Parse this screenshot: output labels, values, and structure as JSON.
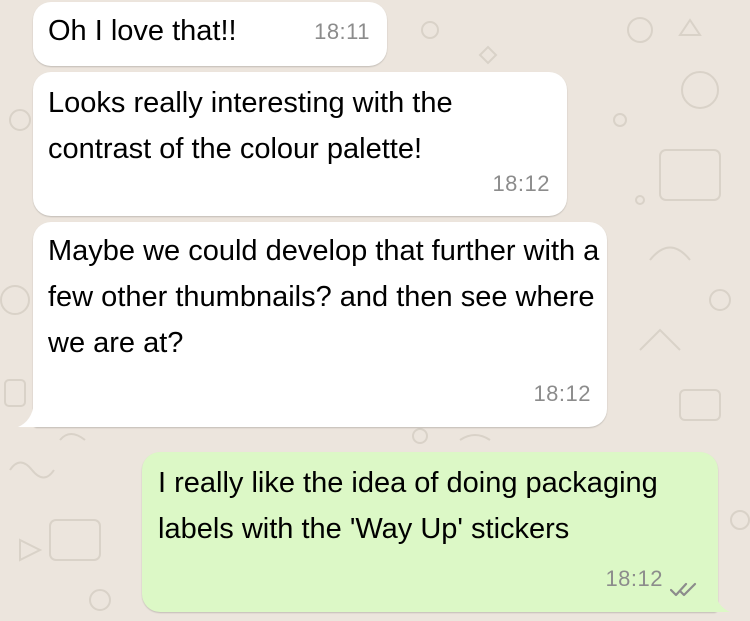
{
  "chat": {
    "messages": [
      {
        "direction": "incoming",
        "text": "Oh I love that!!",
        "time": "18:11"
      },
      {
        "direction": "incoming",
        "text": "Looks really interesting with the contrast of the colour palette!",
        "time": "18:12"
      },
      {
        "direction": "incoming",
        "text": "Maybe we could develop that further with a few other thumbnails? and then see where we are at?",
        "time": "18:12"
      },
      {
        "direction": "outgoing",
        "text": "I really like the idea of doing packaging labels with the 'Way Up' stickers",
        "time": "18:12",
        "status_icon": "double-check-icon"
      }
    ]
  },
  "colors": {
    "background": "#ece5dd",
    "incoming_bubble": "#ffffff",
    "outgoing_bubble": "#dcf8c6",
    "timestamp": "#8c8c8c",
    "read_receipt": "#8c8c8c"
  }
}
